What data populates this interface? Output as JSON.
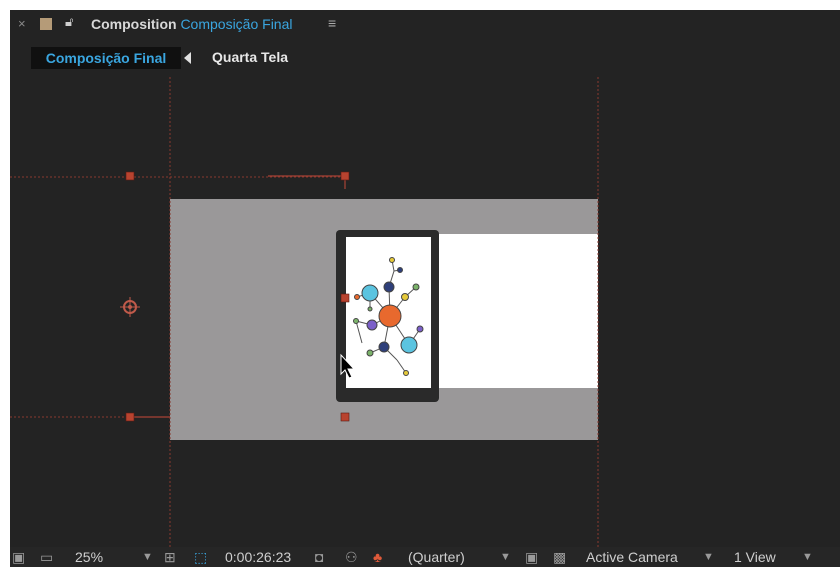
{
  "header": {
    "close_glyph": "×",
    "panel_label": "Composition",
    "comp_name": "Composição Final",
    "menu_glyph": "≡",
    "swatch_color": "#b59b78",
    "accent_color": "#3aa6e0"
  },
  "breadcrumb": {
    "active": "Composição Final",
    "next": "Quarta Tela"
  },
  "toolbar": {
    "zoom": "25%",
    "timecode": "0:00:26:23",
    "resolution": "(Quarter)",
    "camera": "Active Camera",
    "views": "1 View"
  },
  "icons": [
    "close-icon",
    "color-label-icon",
    "lock-icon",
    "panel-menu-icon",
    "nav-back-arrow-icon",
    "preview-icon",
    "monitor-icon",
    "zoom-dropdown-icon",
    "fit-icon",
    "mask-visibility-icon",
    "snapshot-icon",
    "show-snapshot-icon",
    "color-channels-icon",
    "resolution-dropdown-icon",
    "region-of-interest-icon",
    "transparency-grid-icon",
    "camera-dropdown-icon",
    "view-layout-dropdown-icon",
    "mouse-cursor-icon",
    "anchor-point-icon"
  ]
}
